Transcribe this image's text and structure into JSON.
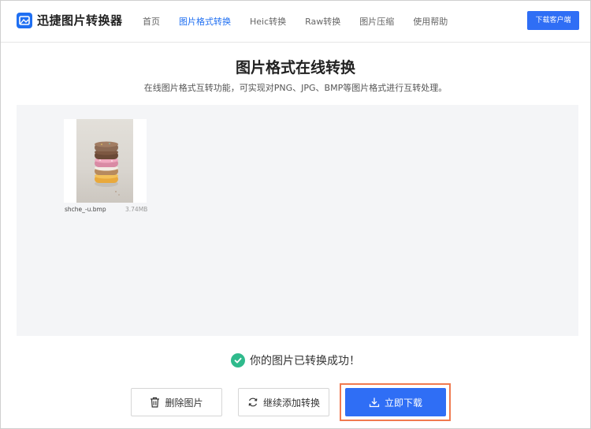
{
  "app": {
    "name": "迅捷图片转换器",
    "brand_color": "#1f6ff2"
  },
  "nav": {
    "items": [
      {
        "label": "首页",
        "active": false
      },
      {
        "label": "图片格式转换",
        "active": true
      },
      {
        "label": "Heic转换",
        "active": false
      },
      {
        "label": "Raw转换",
        "active": false
      },
      {
        "label": "图片压缩",
        "active": false
      },
      {
        "label": "使用帮助",
        "active": false
      }
    ],
    "download_client_label": "下载客户端"
  },
  "main": {
    "title": "图片格式在线转换",
    "subtitle": "在线图片格式互转功能，可实现对PNG、JPG、BMP等图片格式进行互转处理。",
    "file": {
      "name": "shche_-u.bmp",
      "size": "3.74MB",
      "thumbnail": "stacked-donuts-photo"
    },
    "status": {
      "text": "你的图片已转换成功！",
      "color": "#2fba8c"
    }
  },
  "actions": {
    "delete_label": "删除图片",
    "continue_label": "继续添加转换",
    "download_label": "立即下载",
    "highlight_color": "#f07a4f"
  }
}
